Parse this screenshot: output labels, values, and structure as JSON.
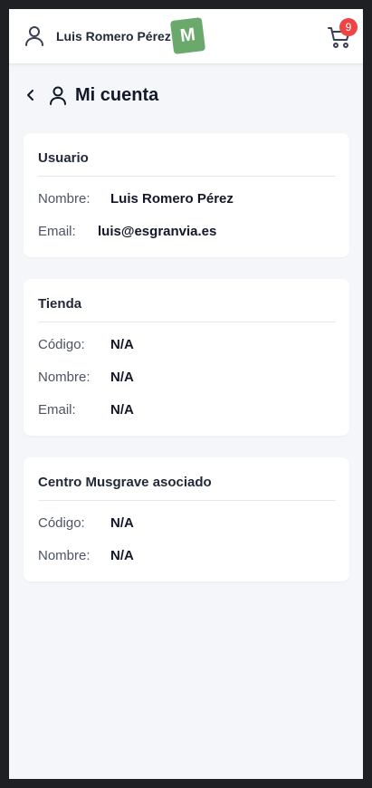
{
  "header": {
    "user_name": "Luis Romero Pérez",
    "logo_letter": "M",
    "cart_count": "9"
  },
  "page": {
    "title": "Mi cuenta"
  },
  "usuario": {
    "title": "Usuario",
    "nombre_label": "Nombre:",
    "nombre_value": "Luis Romero Pérez",
    "email_label": "Email:",
    "email_value": "luis@esgranvia.es"
  },
  "tienda": {
    "title": "Tienda",
    "codigo_label": "Código:",
    "codigo_value": "N/A",
    "nombre_label": "Nombre:",
    "nombre_value": "N/A",
    "email_label": "Email:",
    "email_value": "N/A"
  },
  "centro": {
    "title": "Centro Musgrave asociado",
    "codigo_label": "Código:",
    "codigo_value": "N/A",
    "nombre_label": "Nombre:",
    "nombre_value": "N/A"
  },
  "colors": {
    "logo_green": "#6aa96b",
    "badge_red": "#ef4444",
    "page_bg": "#f5f6f9"
  },
  "icons": {
    "user": "user-icon",
    "cart": "cart-icon",
    "back": "chevron-left-icon"
  }
}
